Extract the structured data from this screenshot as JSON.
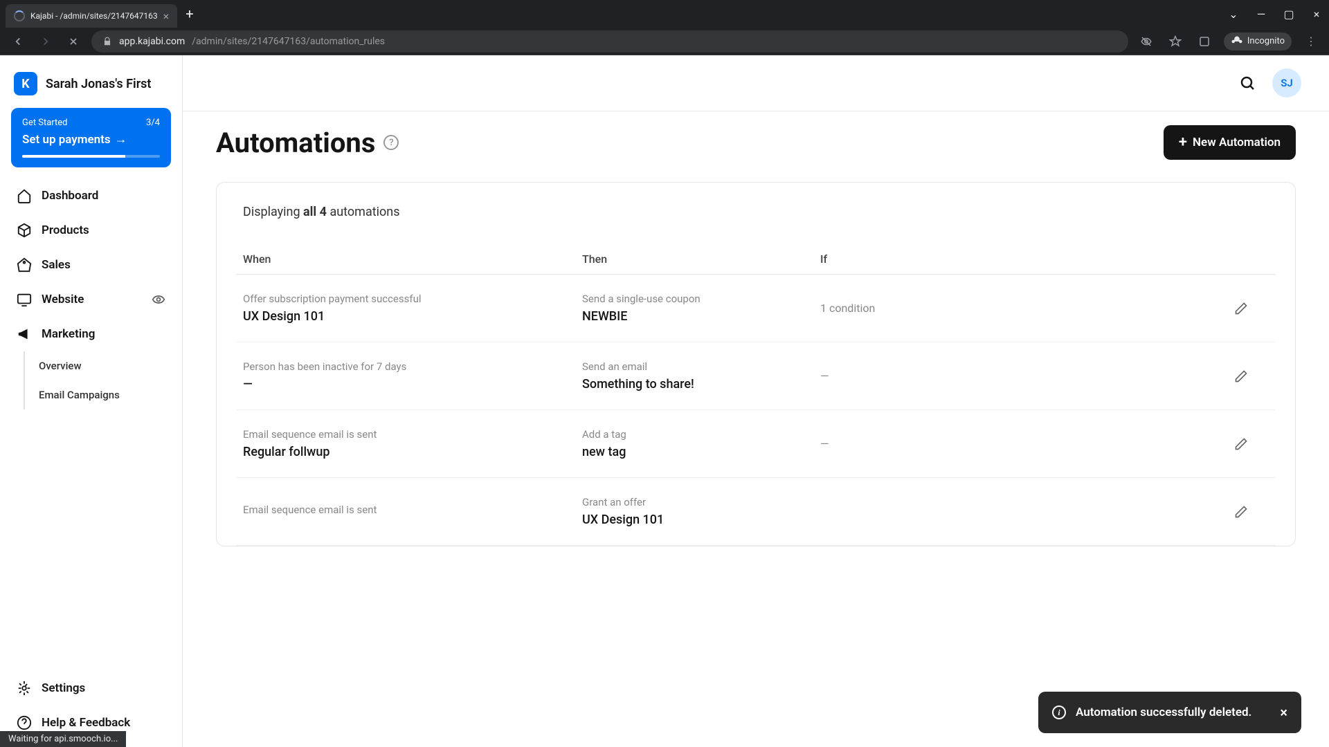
{
  "browser": {
    "tab_title": "Kajabi - /admin/sites/2147647163",
    "url_host": "app.kajabi.com",
    "url_path": "/admin/sites/2147647163/automation_rules",
    "incognito_label": "Incognito",
    "status_text": "Waiting for api.smooch.io..."
  },
  "brand": {
    "logo_letter": "K",
    "name": "Sarah Jonas's First"
  },
  "get_started": {
    "label": "Get Started",
    "progress": "3/4",
    "cta": "Set up payments"
  },
  "nav": {
    "dashboard": "Dashboard",
    "products": "Products",
    "sales": "Sales",
    "website": "Website",
    "marketing": "Marketing",
    "settings": "Settings",
    "help": "Help & Feedback"
  },
  "subnav": {
    "overview": "Overview",
    "email_campaigns": "Email Campaigns"
  },
  "topbar": {
    "avatar_initials": "SJ"
  },
  "page": {
    "title": "Automations",
    "new_button": "New Automation",
    "displaying_pre": "Displaying ",
    "displaying_bold": "all 4",
    "displaying_post": " automations"
  },
  "columns": {
    "when": "When",
    "then": "Then",
    "if": "If"
  },
  "rows": [
    {
      "when_sub": "Offer subscription payment successful",
      "when_main": "UX Design 101",
      "then_sub": "Send a single-use coupon",
      "then_main": "NEWBIE",
      "if": "1 condition"
    },
    {
      "when_sub": "Person has been inactive for 7 days",
      "when_main": "—",
      "then_sub": "Send an email",
      "then_main": "Something to share!",
      "if": "—"
    },
    {
      "when_sub": "Email sequence email is sent",
      "when_main": "Regular follwup",
      "then_sub": "Add a tag",
      "then_main": "new tag",
      "if": "—"
    },
    {
      "when_sub": "Email sequence email is sent",
      "when_main": "",
      "then_sub": "Grant an offer",
      "then_main": "UX Design 101",
      "if": ""
    }
  ],
  "toast": {
    "message": "Automation successfully deleted."
  }
}
